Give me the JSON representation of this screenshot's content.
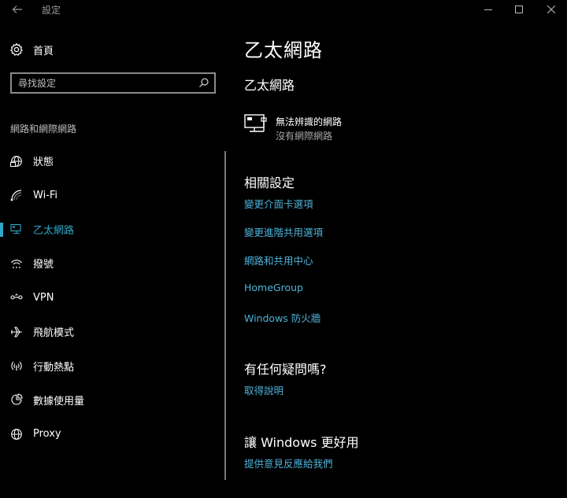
{
  "window": {
    "title": "設定"
  },
  "sidebar": {
    "home_label": "首頁",
    "search_placeholder": "尋找設定",
    "section_label": "網路和網際網路",
    "items": [
      {
        "label": "狀態",
        "icon": "globe-status-icon"
      },
      {
        "label": "Wi-Fi",
        "icon": "wifi-icon"
      },
      {
        "label": "乙太網路",
        "icon": "ethernet-icon",
        "selected": true
      },
      {
        "label": "撥號",
        "icon": "dialup-icon"
      },
      {
        "label": "VPN",
        "icon": "vpn-icon"
      },
      {
        "label": "飛航模式",
        "icon": "airplane-icon"
      },
      {
        "label": "行動熱點",
        "icon": "hotspot-icon"
      },
      {
        "label": "數據使用量",
        "icon": "data-usage-icon"
      },
      {
        "label": "Proxy",
        "icon": "globe-icon"
      }
    ]
  },
  "main": {
    "page_title": "乙太網路",
    "subtitle": "乙太網路",
    "network": {
      "name": "無法辨識的網路",
      "status": "沒有網際網路"
    },
    "related": {
      "heading": "相關設定",
      "links": [
        "變更介面卡選項",
        "變更進階共用選項",
        "網路和共用中心",
        "HomeGroup",
        "Windows 防火牆"
      ]
    },
    "questions": {
      "heading": "有任何疑問嗎?",
      "link": "取得說明"
    },
    "feedback": {
      "heading": "讓 Windows 更好用",
      "link": "提供意見反應給我們"
    }
  },
  "colors": {
    "accent": "#2ea8c6",
    "link": "#4fb3d9",
    "background": "#000000"
  }
}
